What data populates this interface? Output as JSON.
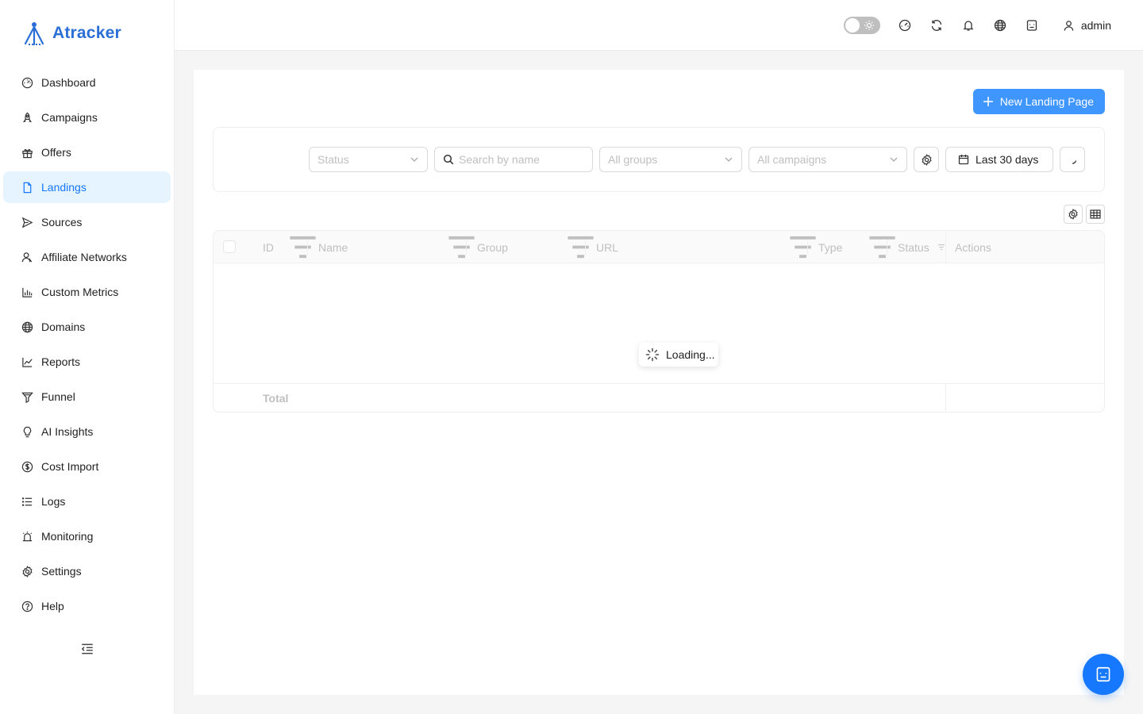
{
  "app": {
    "logo_text": "Atracker",
    "brand_color": "#2b6fd6",
    "accent_color": "#1677ff"
  },
  "header": {
    "icons": [
      "dashboard-gauge-icon",
      "refresh-icon",
      "bell-icon",
      "globe-icon",
      "robot-icon"
    ],
    "user_label": "admin"
  },
  "sidebar": {
    "active": "Landings",
    "items": [
      {
        "label": "Dashboard",
        "icon": "dashboard-icon"
      },
      {
        "label": "Campaigns",
        "icon": "rocket-icon"
      },
      {
        "label": "Offers",
        "icon": "gift-icon"
      },
      {
        "label": "Landings",
        "icon": "file-icon"
      },
      {
        "label": "Sources",
        "icon": "send-icon"
      },
      {
        "label": "Affiliate Networks",
        "icon": "users-icon"
      },
      {
        "label": "Custom Metrics",
        "icon": "bar-chart-icon"
      },
      {
        "label": "Domains",
        "icon": "globe-icon"
      },
      {
        "label": "Reports",
        "icon": "line-chart-icon"
      },
      {
        "label": "Funnel",
        "icon": "funnel-icon"
      },
      {
        "label": "AI Insights",
        "icon": "bulb-icon"
      },
      {
        "label": "Cost Import",
        "icon": "dollar-icon"
      },
      {
        "label": "Logs",
        "icon": "list-icon"
      },
      {
        "label": "Monitoring",
        "icon": "alarm-icon"
      },
      {
        "label": "Settings",
        "icon": "settings-icon"
      },
      {
        "label": "Help",
        "icon": "help-icon"
      }
    ]
  },
  "toolbar": {
    "new_button_label": "New Landing Page"
  },
  "filters": {
    "status_placeholder": "Status",
    "search_placeholder": "Search by name",
    "groups_placeholder": "All groups",
    "campaigns_placeholder": "All campaigns",
    "date_range_label": "Last 30 days"
  },
  "table": {
    "columns": [
      "ID",
      "Name",
      "Group",
      "URL",
      "Type",
      "Status",
      "Actions"
    ],
    "loading_text": "Loading...",
    "footer_total_label": "Total"
  }
}
